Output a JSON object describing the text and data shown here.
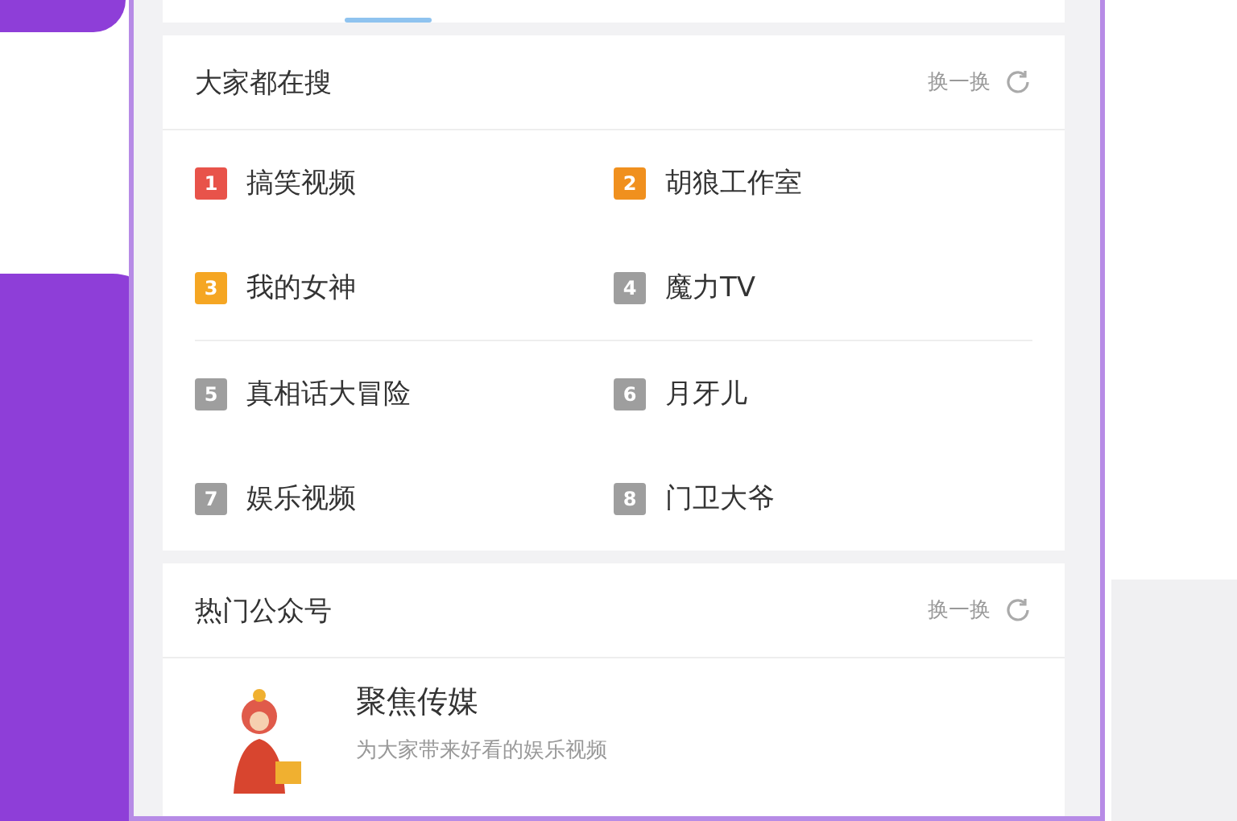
{
  "trending": {
    "title": "大家都在搜",
    "refresh": "换一换",
    "items": [
      {
        "rank": "1",
        "name": "搞笑视频",
        "color": "#e8534a"
      },
      {
        "rank": "2",
        "name": "胡狼工作室",
        "color": "#f0901e"
      },
      {
        "rank": "3",
        "name": "我的女神",
        "color": "#f5a623"
      },
      {
        "rank": "4",
        "name": "魔力TV",
        "color": "#9e9e9e"
      },
      {
        "rank": "5",
        "name": "真相话大冒险",
        "color": "#9e9e9e"
      },
      {
        "rank": "6",
        "name": "月牙儿",
        "color": "#9e9e9e"
      },
      {
        "rank": "7",
        "name": "娱乐视频",
        "color": "#9e9e9e"
      },
      {
        "rank": "8",
        "name": "门卫大爷",
        "color": "#9e9e9e"
      }
    ]
  },
  "accounts": {
    "title": "热门公众号",
    "refresh": "换一换",
    "items": [
      {
        "name": "聚焦传媒",
        "description": "为大家带来好看的娱乐视频"
      }
    ]
  }
}
